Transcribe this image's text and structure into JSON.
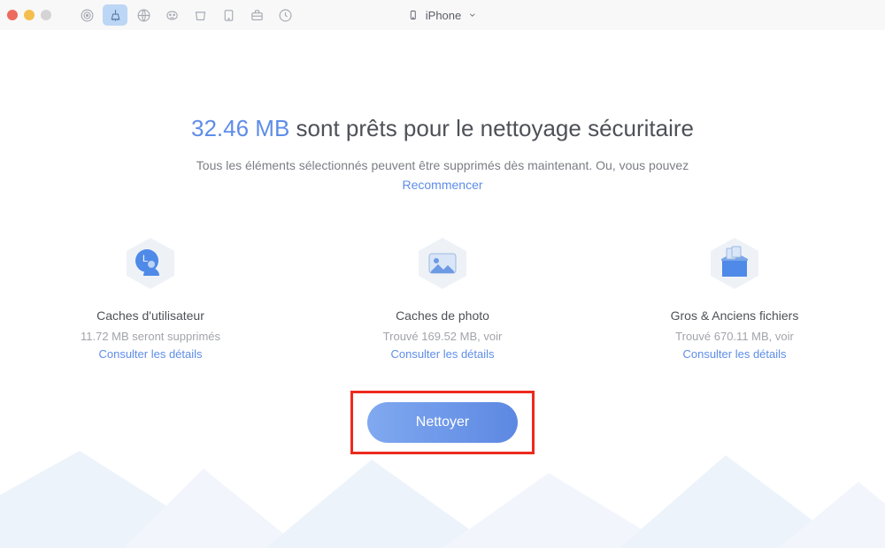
{
  "device": {
    "name": "iPhone"
  },
  "headline": {
    "size": "32.46 MB",
    "rest": " sont prêts pour le nettoyage sécuritaire"
  },
  "subline": "Tous les éléments sélectionnés peuvent être supprimés dès maintenant. Ou, vous pouvez",
  "restart": "Recommencer",
  "cards": [
    {
      "title": "Caches d'utilisateur",
      "sub": "11.72 MB seront supprimés",
      "link": "Consulter les détails"
    },
    {
      "title": "Caches de photo",
      "sub": "Trouvé 169.52 MB, voir",
      "link": "Consulter les détails"
    },
    {
      "title": "Gros & Anciens fichiers",
      "sub": "Trouvé 670.11 MB, voir",
      "link": "Consulter les détails"
    }
  ],
  "action": {
    "clean": "Nettoyer"
  }
}
